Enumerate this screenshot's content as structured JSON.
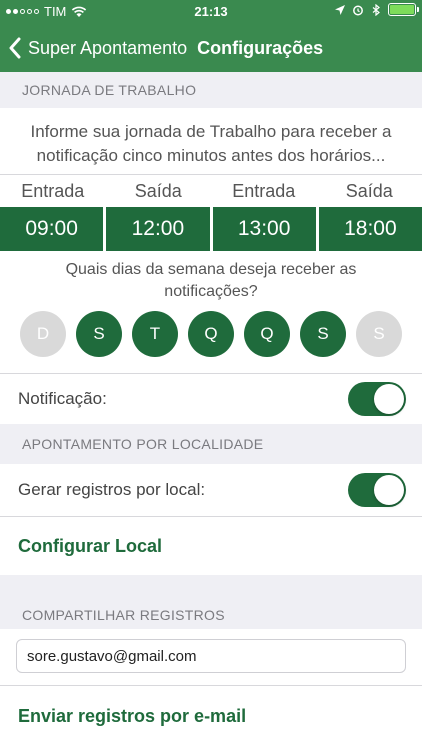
{
  "status_bar": {
    "carrier": "TIM",
    "time": "21:13",
    "battery_color": "#7ddc5b"
  },
  "nav": {
    "back_label": "Super Apontamento",
    "title": "Configurações"
  },
  "jornada": {
    "section_title": "JORNADA DE TRABALHO",
    "info_line1": "Informe sua jornada de Trabalho para receber a",
    "info_line2": "notificação cinco minutos antes dos horários...",
    "columns": [
      "Entrada",
      "Saída",
      "Entrada",
      "Saída"
    ],
    "times": [
      "09:00",
      "12:00",
      "13:00",
      "18:00"
    ],
    "days_question_line1": "Quais dias da semana deseja receber as",
    "days_question_line2": "notificações?",
    "days": [
      {
        "label": "D",
        "selected": false
      },
      {
        "label": "S",
        "selected": true
      },
      {
        "label": "T",
        "selected": true
      },
      {
        "label": "Q",
        "selected": true
      },
      {
        "label": "Q",
        "selected": true
      },
      {
        "label": "S",
        "selected": true
      },
      {
        "label": "S",
        "selected": false
      }
    ],
    "notification_label": "Notificação:",
    "notification_on": true
  },
  "localidade": {
    "section_title": "APONTAMENTO POR LOCALIDADE",
    "gerar_label": "Gerar registros por local:",
    "gerar_on": true,
    "configurar_label": "Configurar Local"
  },
  "compartilhar": {
    "section_title": "COMPARTILHAR REGISTROS",
    "email_value": "sore.gustavo@gmail.com",
    "send_label": "Enviar registros por e-mail"
  },
  "colors": {
    "header_green": "#3a8a4f",
    "accent_green": "#1f6b3c",
    "section_bg": "#efeff4",
    "day_off": "#d9d9d9"
  }
}
